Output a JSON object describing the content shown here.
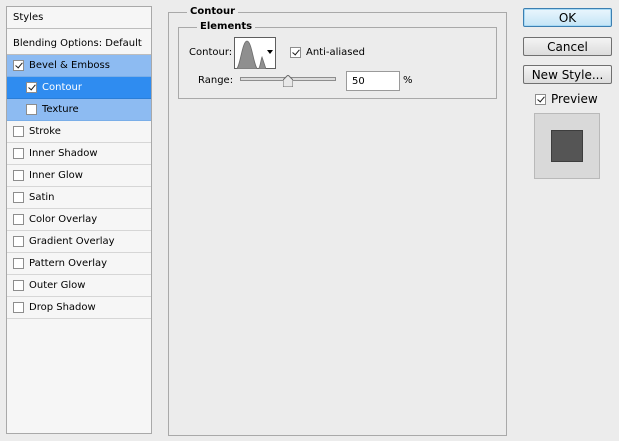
{
  "styles_list": {
    "header": "Styles",
    "blending_options": "Blending Options: Default",
    "items": [
      {
        "label": "Bevel & Emboss",
        "checked": true
      },
      {
        "label": "Contour",
        "checked": true
      },
      {
        "label": "Texture",
        "checked": false
      },
      {
        "label": "Stroke",
        "checked": false
      },
      {
        "label": "Inner Shadow",
        "checked": false
      },
      {
        "label": "Inner Glow",
        "checked": false
      },
      {
        "label": "Satin",
        "checked": false
      },
      {
        "label": "Color Overlay",
        "checked": false
      },
      {
        "label": "Gradient Overlay",
        "checked": false
      },
      {
        "label": "Pattern Overlay",
        "checked": false
      },
      {
        "label": "Outer Glow",
        "checked": false
      },
      {
        "label": "Drop Shadow",
        "checked": false
      }
    ]
  },
  "contour_panel": {
    "title": "Contour",
    "elements_title": "Elements",
    "contour_label": "Contour:",
    "anti_aliased_label": "Anti-aliased",
    "anti_aliased_checked": true,
    "range_label": "Range:",
    "range_value": "50",
    "range_unit": "%",
    "range_percent": 50
  },
  "buttons": {
    "ok": "OK",
    "cancel": "Cancel",
    "new_style": "New Style...",
    "preview_label": "Preview",
    "preview_checked": true
  },
  "colors": {
    "selection_light": "#8dbbf2",
    "selection_dark": "#2f8cf0",
    "preview_swatch": "#555555"
  }
}
